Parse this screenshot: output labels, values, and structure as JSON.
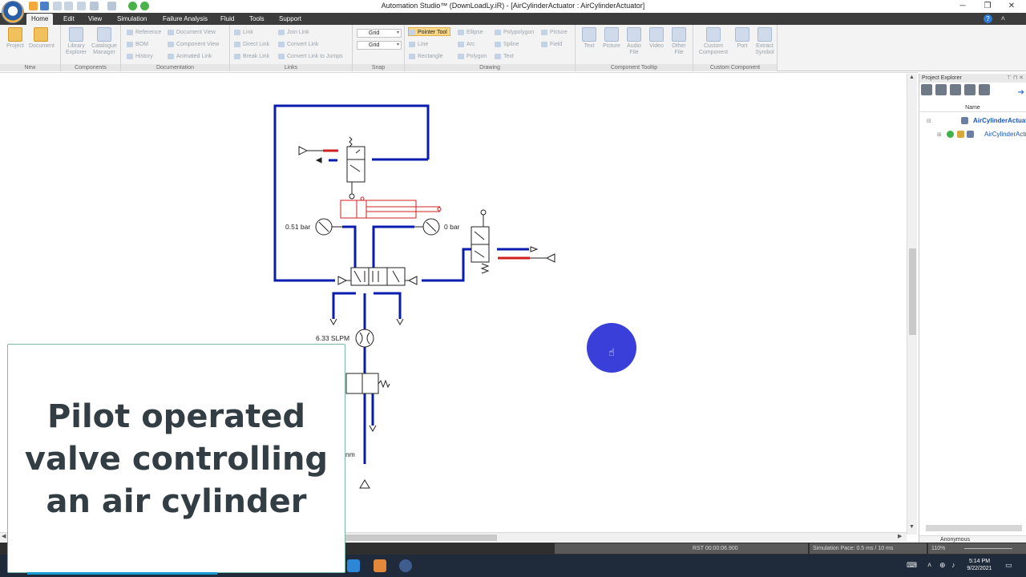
{
  "window": {
    "title": "Automation Studio™ (DownLoadLy.iR) - [AirCylinderActuator : AirCylinderActuator]",
    "minimize": "─",
    "maximize": "❐",
    "close": "✕"
  },
  "menu": {
    "tabs": [
      "Home",
      "Edit",
      "View",
      "Simulation",
      "Failure Analysis",
      "Fluid",
      "Tools",
      "Support"
    ],
    "help_icon": "?",
    "collapse_icon": "˄"
  },
  "ribbon": {
    "new": {
      "name": "New",
      "project": "Project",
      "document": "Document"
    },
    "components": {
      "name": "Components",
      "library_explorer": "Library Explorer",
      "catalogue_manager": "Catalogue Manager"
    },
    "documentation": {
      "name": "Documentation",
      "reference": "Reference",
      "bom": "BOM",
      "history": "History",
      "document_view": "Document View",
      "component_view": "Component View",
      "animated_link": "Animated Link"
    },
    "links": {
      "name": "Links",
      "link": "Link",
      "direct_link": "Direct Link",
      "break_link": "Break Link",
      "join_link": "Join Link",
      "convert_link": "Convert Link",
      "convert_link_to_jumps": "Convert Link to Jumps"
    },
    "snap": {
      "name": "Snap",
      "grid1": "Grid",
      "grid2": "Grid"
    },
    "drawing": {
      "name": "Drawing",
      "pointer_tool": "Pointer Tool",
      "line": "Line",
      "rectangle": "Rectangle",
      "ellipse": "Ellipse",
      "arc": "Arc",
      "polygon": "Polygon",
      "polypolygon": "Polypolygon",
      "spline": "Spline",
      "text": "Text",
      "picture": "Picture",
      "field": "Field"
    },
    "component_tooltip": {
      "name": "Component Tooltip",
      "text": "Text",
      "picture": "Picture",
      "audio_file": "Audio File",
      "video": "Video",
      "other_file": "Other File"
    },
    "custom_component": {
      "name": "Custom Component",
      "custom_component": "Custom Component",
      "port": "Port",
      "extract_symbol": "Extract Symbol"
    }
  },
  "diagram": {
    "gauge_left_label": "0.51 bar",
    "gauge_right_label": "0 bar",
    "flow_label": "6.33 SLPM",
    "partial_label": "nm"
  },
  "caption": {
    "line1": "Pilot operated",
    "line2": "valve controlling",
    "line3": "an air cylinder"
  },
  "explorer": {
    "title": "Project Explorer",
    "controls": "⊤ ⊓ ✕",
    "column_name": "Name",
    "root": "AirCylinderActuator",
    "child": "AirCylinderActuator",
    "user": "Anonymous"
  },
  "statusbar": {
    "rst": "RST 00:00:06.900",
    "pace": "Simulation Pace: 0.5 ms / 10 ms",
    "zoom": "110%"
  },
  "taskbar": {
    "time": "5:14 PM",
    "date": "9/22/2021"
  },
  "colors": {
    "pressure_line": "#0a1cb0",
    "pressure_hot": "#d11f1f",
    "cursor_halo": "#2a2fd6",
    "caption_text": "#333d44"
  }
}
